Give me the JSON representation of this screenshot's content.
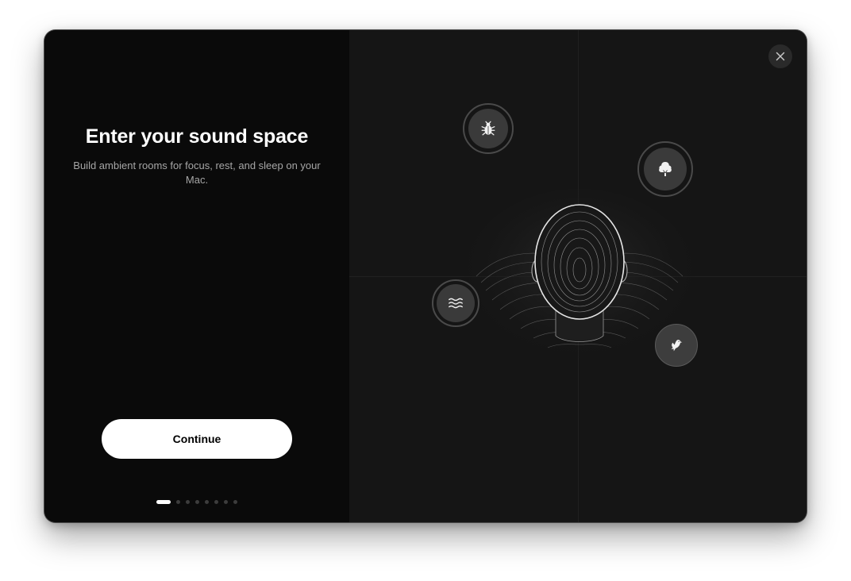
{
  "onboarding": {
    "title": "Enter your sound space",
    "subtitle": "Build ambient rooms for focus, rest, and sleep on your Mac.",
    "continue_label": "Continue",
    "page_count": 8,
    "current_page": 1
  },
  "scene": {
    "sound_nodes": [
      {
        "name": "insects",
        "icon": "bug-icon"
      },
      {
        "name": "forest",
        "icon": "tree-icon"
      },
      {
        "name": "water",
        "icon": "waves-icon"
      },
      {
        "name": "birds",
        "icon": "bird-icon"
      }
    ],
    "close_icon": "close-icon"
  },
  "colors": {
    "left_pane_bg": "#0a0a0a",
    "right_pane_bg": "#151515",
    "accent": "#ffffff",
    "muted_text": "#a6a6a6"
  }
}
